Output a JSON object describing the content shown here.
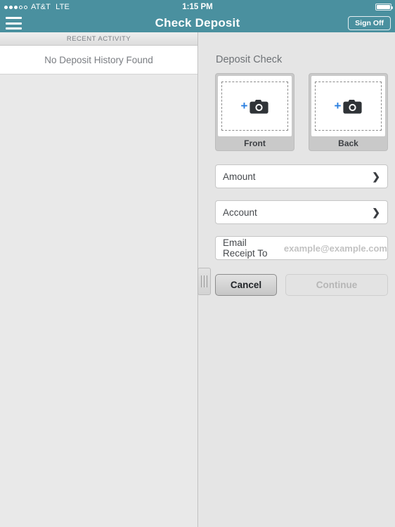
{
  "status_bar": {
    "signal_dots_filled": 3,
    "signal_dots_total": 5,
    "carrier": "AT&T",
    "network": "LTE",
    "time": "1:15 PM",
    "battery_icon": "battery-icon"
  },
  "nav": {
    "menu_icon": "hamburger-menu-icon",
    "title": "Check Deposit",
    "sign_off_label": "Sign Off",
    "accent_color": "#4a909f"
  },
  "left_panel": {
    "section_header": "RECENT ACTIVITY",
    "empty_message": "No Deposit History Found"
  },
  "deposit": {
    "title": "Deposit Check",
    "cards": [
      {
        "label": "Front",
        "plus": "+",
        "icon": "camera-icon"
      },
      {
        "label": "Back",
        "plus": "+",
        "icon": "camera-icon"
      }
    ],
    "fields": [
      {
        "label": "Amount",
        "value": "",
        "accessory": "chevron-right-icon"
      },
      {
        "label": "Account",
        "value": "",
        "accessory": "chevron-right-icon"
      }
    ],
    "email_field": {
      "label": "Email Receipt To",
      "value": "",
      "placeholder": "example@example.com"
    },
    "buttons": {
      "cancel": "Cancel",
      "continue": "Continue"
    },
    "plus_color": "#2a7fe0"
  },
  "splitter": {
    "handle_icon": "drag-handle-icon"
  }
}
